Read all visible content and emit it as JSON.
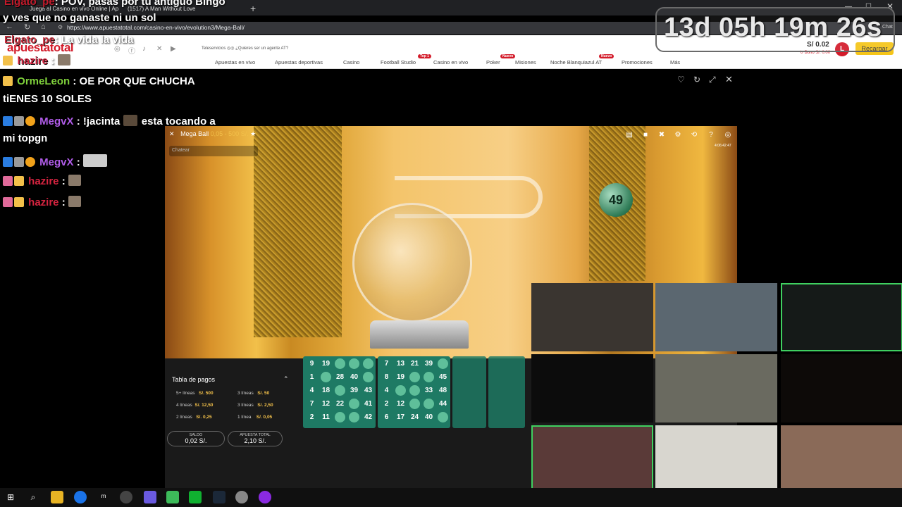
{
  "browser": {
    "tabs": [
      {
        "label": "Juega al Casino en vivo Online | Ap"
      },
      {
        "label": "(1517) A Man Without Love"
      }
    ],
    "url": "https://www.apuestatotal.com/casino-en-vivo/evolution3/Mega-Ball/",
    "chat_label": "Chat"
  },
  "overlay": {
    "top_name": "Elgato_pe",
    "top_text": ": POV, pasas por tu antiguo Bingo",
    "line2": "y ves que no ganaste ni un sol",
    "line3_name": "Elgato_pe",
    "line3_text": ": La vida la vida",
    "hazire_name": "hazire",
    "hazire_sep": ":"
  },
  "countdown": "13d 05h 19m 26s",
  "site": {
    "logo": "apuestatotal",
    "teleservicios": "Teleservicios",
    "agent": "¿Quieres ser un agente AT?",
    "nav": [
      "Apuestas en vivo",
      "Apuestas deportivas",
      "Casino",
      "Football Studio",
      "Casino en vivo",
      "Poker",
      "Misiones",
      "Noche Blanquiazul AT",
      "Promociones",
      "Más"
    ],
    "badges": {
      "football": "Top 1",
      "poker": "Nuevo",
      "noche": "Nuevo"
    },
    "balance": "S/ 0.02",
    "balance_sub": "↻ Bono S/. 0.00",
    "avatar_letter": "L",
    "recargar": "Recargar"
  },
  "chat": [
    {
      "name": "OrmeLeon",
      "name_color": "#7fd13b",
      "text": ": OE POR QUE CHUCHA"
    },
    {
      "name": "",
      "text": "tiENES 10 SOLES"
    },
    {
      "name": "MegvX",
      "name_color": "#b05ce8",
      "text": ": !jacinta",
      "text2": "esta tocando a"
    },
    {
      "name": "",
      "text": "mi topgn"
    },
    {
      "name": "MegvX",
      "name_color": "#b05ce8",
      "text": ":"
    },
    {
      "name": "hazire",
      "name_color": "#d62440",
      "text": ":"
    },
    {
      "name": "hazire",
      "name_color": "#d62440",
      "text": ":"
    }
  ],
  "game": {
    "title": "Mega Ball",
    "limits": "0,05 - 500 S/.",
    "chat_placeholder": "Chatear",
    "time": "4:06:42:47",
    "drawn_ball": "49",
    "paytable_title": "Tabla de pagos",
    "paytable": [
      {
        "l1": "5+ líneas",
        "v1": "S/. 500",
        "l2": "3 líneas",
        "v2": "S/. 50"
      },
      {
        "l1": "4 líneas",
        "v1": "S/. 12,50",
        "l2": "3 líneas",
        "v2": "S/. 2,50"
      },
      {
        "l1": "2 líneas",
        "v1": "S/. 0,25",
        "l2": "1 línea",
        "v2": "S/. 0,05"
      }
    ],
    "saldo_label": "SALDO",
    "saldo_value": "0,02 S/.",
    "apuesta_label": "APUESTA TOTAL",
    "apuesta_value": "2,10 S/.",
    "card1": [
      [
        "9",
        "19",
        "",
        "",
        ""
      ],
      [
        "1",
        "",
        "28",
        "40",
        ""
      ],
      [
        "4",
        "18",
        "",
        "39",
        "43"
      ],
      [
        "7",
        "12",
        "22",
        "",
        "41"
      ],
      [
        "2",
        "11",
        "",
        "",
        "42"
      ]
    ],
    "card1_col5": [
      "",
      "",
      "",
      "",
      ""
    ],
    "card2": [
      [
        "7",
        "13",
        "21",
        "39",
        ""
      ],
      [
        "8",
        "19",
        "",
        "",
        "45"
      ],
      [
        "4",
        "",
        "",
        "33",
        "48"
      ],
      [
        "2",
        "12",
        "",
        "",
        "44"
      ],
      [
        "6",
        "17",
        "24",
        "40",
        ""
      ]
    ]
  },
  "colors": {
    "accent": "#d31b2a",
    "card_green": "#1e7a64",
    "ball_hit": "#5fbf9a",
    "cam_active": "#3fd060"
  }
}
